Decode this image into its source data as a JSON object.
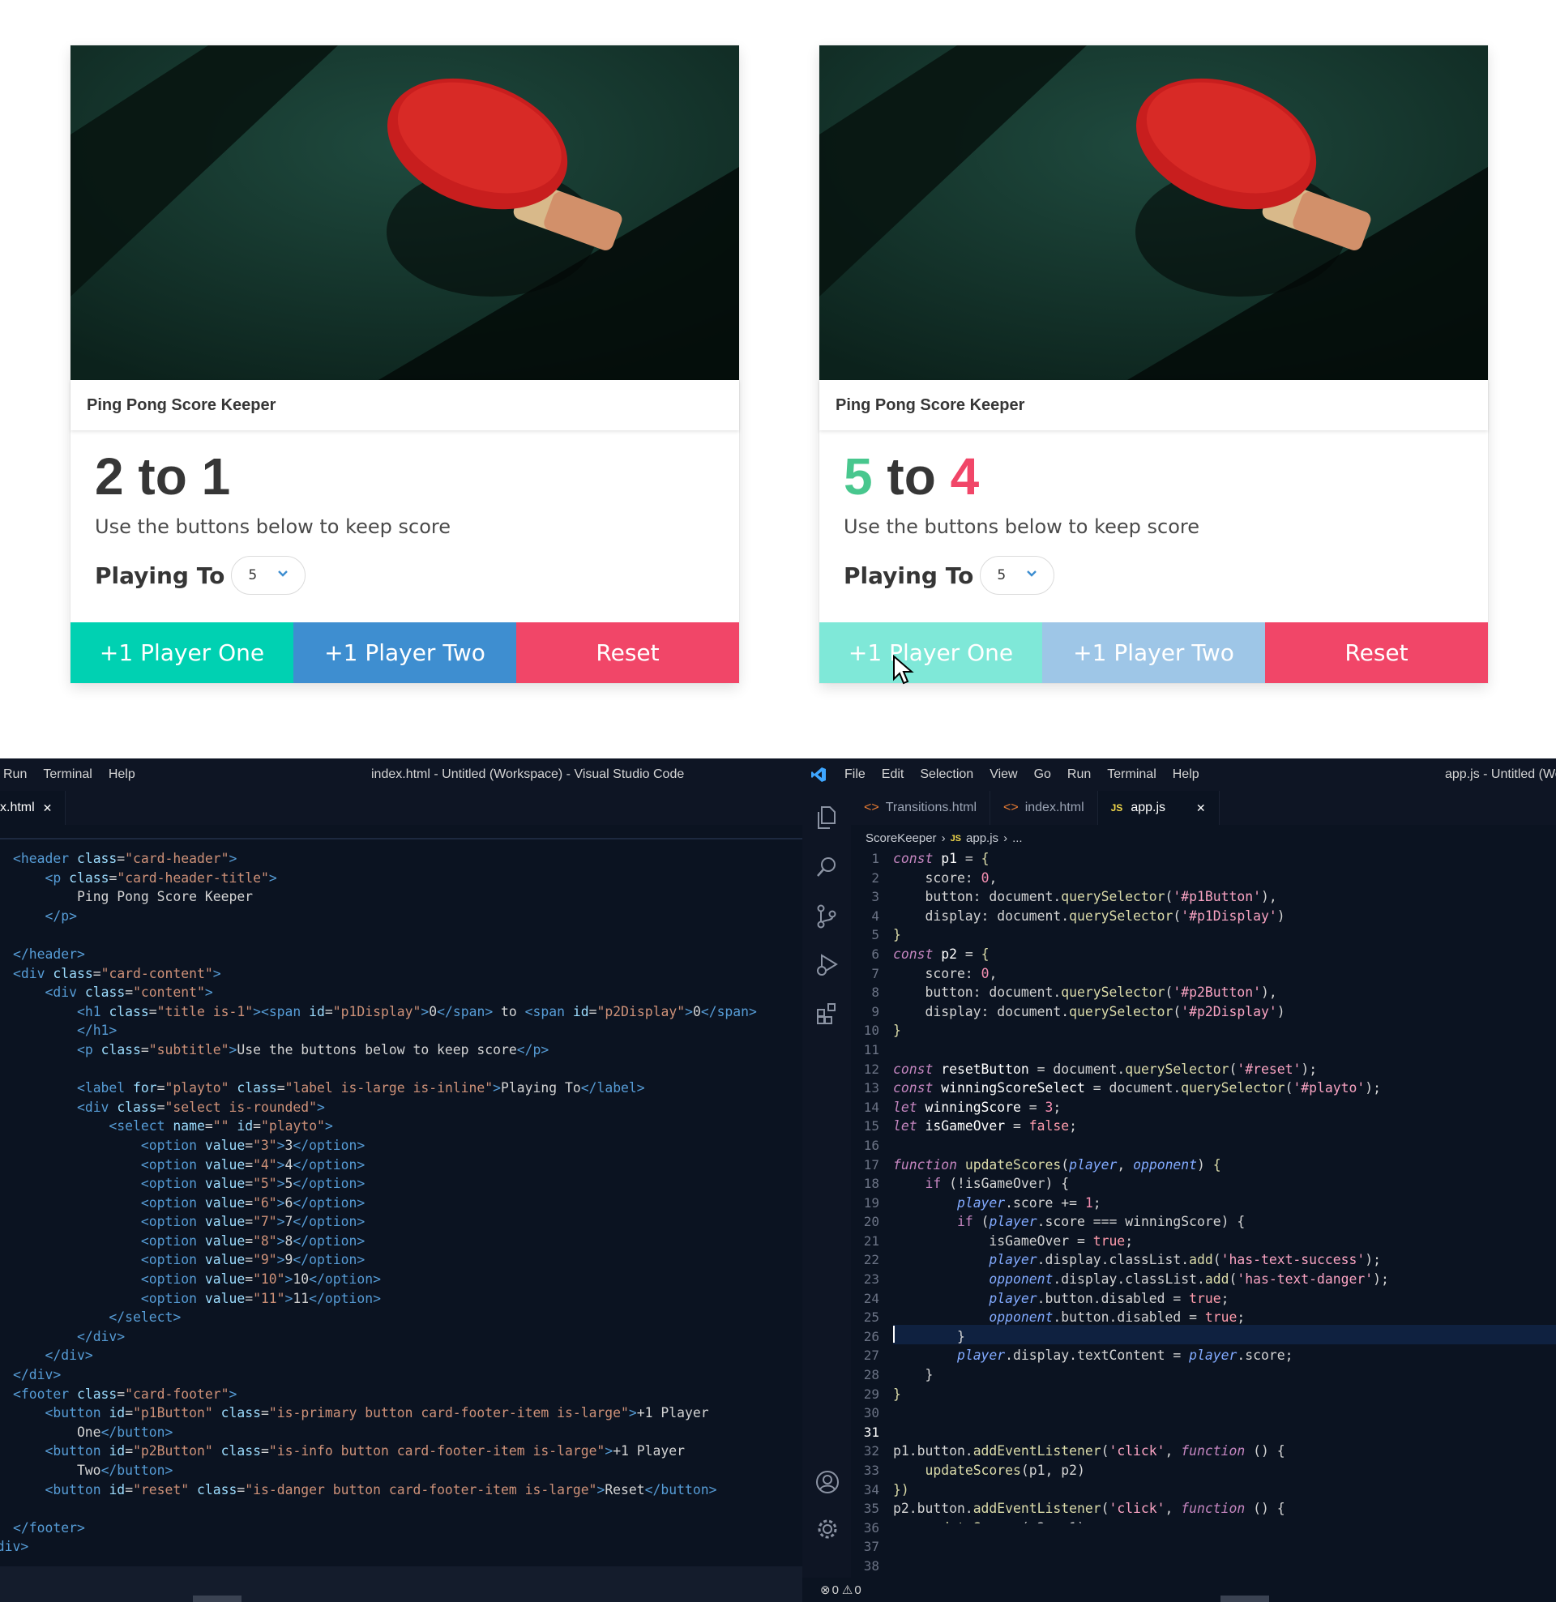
{
  "cards": [
    {
      "header_title": "Ping Pong Score Keeper",
      "score_p1": "2",
      "score_sep": " to ",
      "score_p2": "1",
      "subtitle": "Use the buttons below to keep score",
      "playing_to_label": "Playing To",
      "select_value": "5",
      "buttons": [
        "+1 Player One",
        "+1 Player Two",
        "Reset"
      ]
    },
    {
      "header_title": "Ping Pong Score Keeper",
      "score_p1": "5",
      "score_sep": " to ",
      "score_p2": "4",
      "subtitle": "Use the buttons below to keep score",
      "playing_to_label": "Playing To",
      "select_value": "5",
      "buttons": [
        "+1 Player One",
        "+1 Player Two",
        "Reset"
      ]
    }
  ],
  "editor_left": {
    "menu": [
      "Run",
      "Terminal",
      "Help"
    ],
    "title": "index.html - Untitled (Workspace) - Visual Studio Code",
    "tab": "x.html",
    "tab_close": "✕"
  },
  "editor_right": {
    "menu": [
      "File",
      "Edit",
      "Selection",
      "View",
      "Go",
      "Run",
      "Terminal",
      "Help"
    ],
    "title": "app.js - Untitled (Wo",
    "tabs": [
      "Transitions.html",
      "index.html",
      "app.js"
    ],
    "tab_close": "✕",
    "breadcrumb": [
      "ScoreKeeper",
      "app.js",
      "..."
    ],
    "status_errors": "0",
    "status_warnings": "0"
  },
  "colors": {
    "primary": "#00d1b2",
    "info": "#3e8ed0",
    "danger": "#f14668",
    "success": "#48c78e",
    "editor_bg": "#0b1321"
  }
}
